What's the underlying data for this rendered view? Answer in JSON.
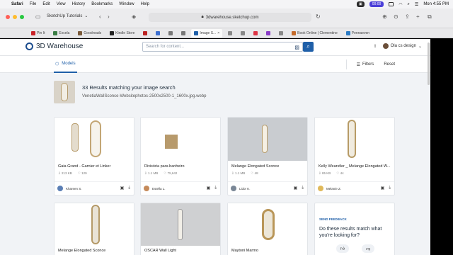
{
  "menubar": {
    "app": "Safari",
    "items": [
      "File",
      "Edit",
      "View",
      "History",
      "Bookmarks",
      "Window",
      "Help"
    ],
    "recording": "00:00",
    "clock": "Mon 4:55 PM"
  },
  "browser": {
    "tab_title": "SketchUp Tutorials",
    "url": "3dwarehouse.sketchup.com",
    "bookmarks": [
      "Pin It",
      "Excela",
      "Goodreads",
      "Kindle Store",
      "",
      "",
      "",
      "",
      "Image S...",
      "",
      "",
      "",
      "",
      "",
      "Book Online | Clementine",
      "Pennaeven"
    ]
  },
  "header": {
    "logo": "3D Warehouse",
    "search_placeholder": "Search for content...",
    "user": "Ola cs design"
  },
  "subnav": {
    "tab": "Models",
    "filters": "Filters",
    "reset": "Reset"
  },
  "results": {
    "title": "33 Results matching your image search",
    "file": "VenetiaWallSconce-Websitephotos-2500x2500-1_1600x.jpg.webp"
  },
  "cards": [
    {
      "title": "Gaia Grand - Garnier et Linker",
      "size": "213 KB",
      "likes": "129",
      "user": "Khareen S."
    },
    {
      "title": "Divisória para banheiro",
      "size": "1.1 MB",
      "likes": "75,642",
      "user": "Estella L."
    },
    {
      "title": "Melange Elongated Sconce",
      "size": "1.1 MB",
      "likes": "48",
      "user": "Lidor K."
    },
    {
      "title": "Kelly Wearstler _ Melange Elongated W...",
      "size": "85 KB",
      "likes": "44",
      "user": "Melanie Z."
    },
    {
      "title": "Melange Elongated Sconce"
    },
    {
      "title": "OSCAR Wall Light"
    },
    {
      "title": "Maytoni Marmo"
    }
  ],
  "feedback": {
    "label": "SEND FEEDBACK",
    "question": "Do these results match what you're looking for?"
  },
  "icons": {
    "search": "search-icon",
    "image_search": "image-icon",
    "download": "download-icon",
    "add_collection": "collection-icon",
    "share": "share-icon"
  },
  "colors": {
    "accent": "#1f5fa8",
    "page_bg": "#f1f3f6"
  }
}
